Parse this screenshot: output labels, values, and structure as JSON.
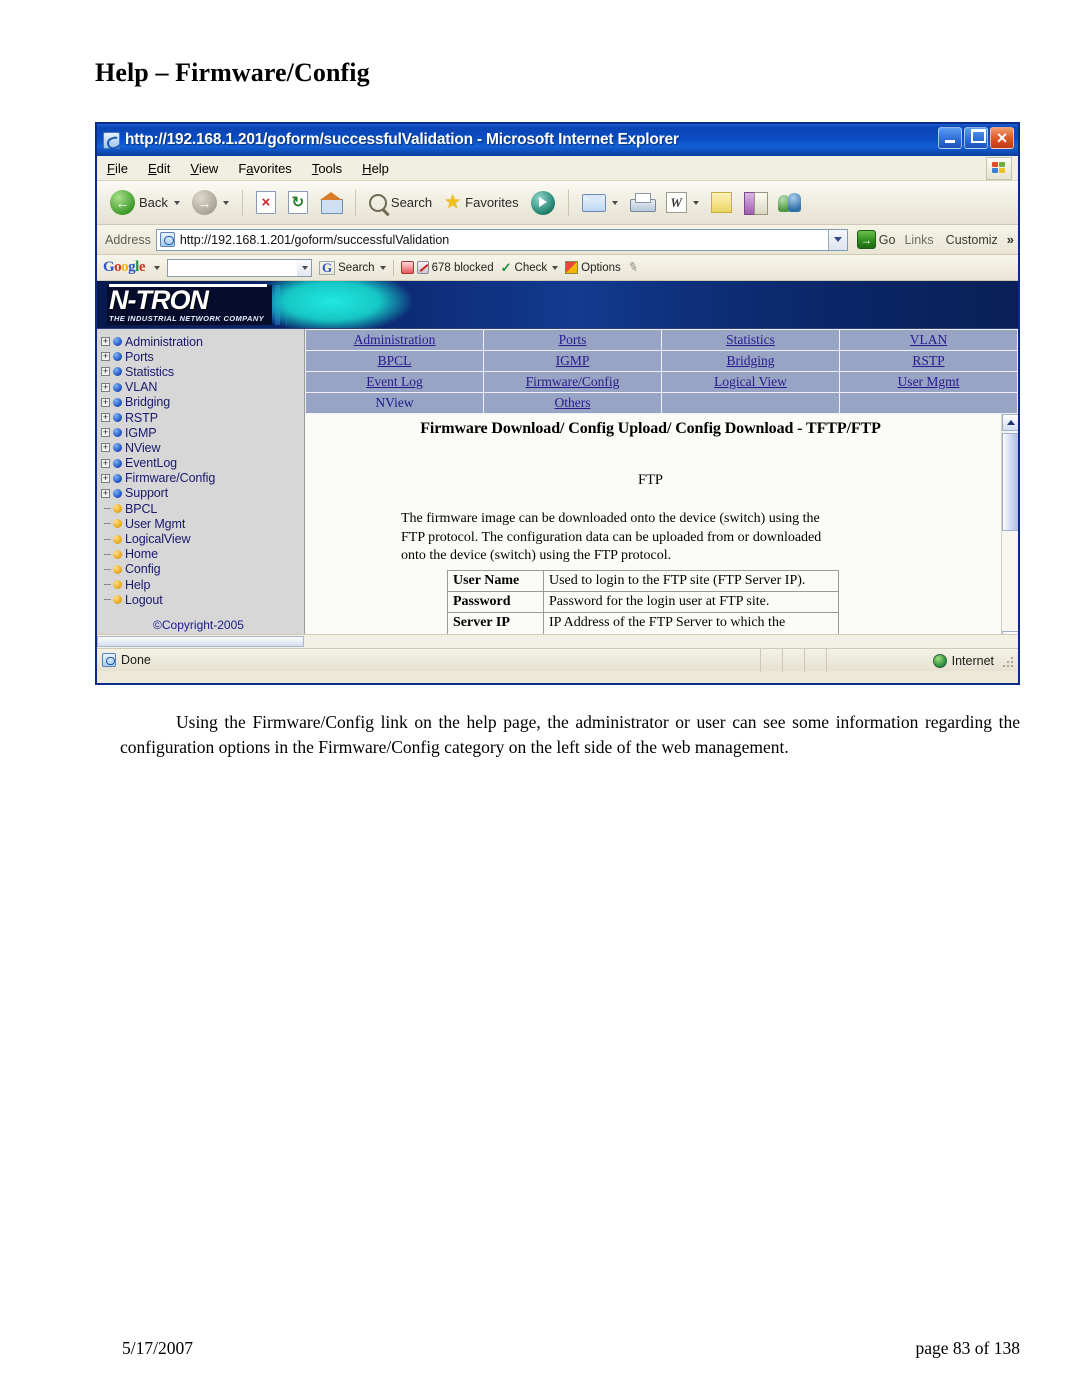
{
  "document": {
    "heading": "Help – Firmware/Config",
    "body_paragraph": "Using the Firmware/Config link on the help page, the administrator or user can see some information regarding the configuration options in the Firmware/Config category on the left side of the web management.",
    "footer_date": "5/17/2007",
    "footer_page": "page 83 of 138"
  },
  "browser": {
    "title": "http://192.168.1.201/goform/successfulValidation - Microsoft Internet Explorer",
    "window_buttons": [
      "minimize",
      "maximize",
      "close"
    ],
    "menu": [
      "File",
      "Edit",
      "View",
      "Favorites",
      "Tools",
      "Help"
    ],
    "toolbar": {
      "back_label": "Back",
      "forward_label": "",
      "stop_label": "",
      "refresh_label": "",
      "home_label": "",
      "search_label": "Search",
      "favorites_label": "Favorites",
      "media_label": "",
      "mail_label": "",
      "print_label": "",
      "edit_label": "W",
      "notes_label": "",
      "research_label": "",
      "messenger_label": ""
    },
    "address": {
      "label": "Address",
      "value": "http://192.168.1.201/goform/successfulValidation",
      "go_label": "Go",
      "links_label": "Links",
      "customize_label": "Customiz",
      "overflow_label": "»"
    },
    "google_toolbar": {
      "logo": "Google",
      "search_value": "",
      "search_label": "Search",
      "blocked_label": "678 blocked",
      "check_label": "Check",
      "options_label": "Options"
    },
    "status": {
      "text": "Done",
      "zone": "Internet"
    }
  },
  "webpage": {
    "banner": {
      "logo_main": "N-TRON",
      "logo_sub": "THE INDUSTRIAL NETWORK COMPANY"
    },
    "sidebar": {
      "items": [
        {
          "label": "Administration",
          "expandable": true,
          "dot": "blue"
        },
        {
          "label": "Ports",
          "expandable": true,
          "dot": "blue"
        },
        {
          "label": "Statistics",
          "expandable": true,
          "dot": "blue"
        },
        {
          "label": "VLAN",
          "expandable": true,
          "dot": "blue"
        },
        {
          "label": "Bridging",
          "expandable": true,
          "dot": "blue"
        },
        {
          "label": "RSTP",
          "expandable": true,
          "dot": "blue"
        },
        {
          "label": "IGMP",
          "expandable": true,
          "dot": "blue"
        },
        {
          "label": "NView",
          "expandable": true,
          "dot": "blue"
        },
        {
          "label": "EventLog",
          "expandable": true,
          "dot": "blue"
        },
        {
          "label": "Firmware/Config",
          "expandable": true,
          "dot": "blue"
        },
        {
          "label": "Support",
          "expandable": true,
          "dot": "blue"
        },
        {
          "label": "BPCL",
          "expandable": false,
          "dot": "gold"
        },
        {
          "label": "User Mgmt",
          "expandable": false,
          "dot": "gold"
        },
        {
          "label": "LogicalView",
          "expandable": false,
          "dot": "gold"
        },
        {
          "label": "Home",
          "expandable": false,
          "dot": "gold"
        },
        {
          "label": "Config",
          "expandable": false,
          "dot": "gold"
        },
        {
          "label": "Help",
          "expandable": false,
          "dot": "gold"
        },
        {
          "label": "Logout",
          "expandable": false,
          "dot": "gold"
        }
      ],
      "copyright": "©Copyright-2005",
      "url": "http://www.n-tron.com"
    },
    "link_grid": {
      "rows": [
        [
          {
            "label": "Administration",
            "link": true
          },
          {
            "label": "Ports",
            "link": true
          },
          {
            "label": "Statistics",
            "link": true
          },
          {
            "label": "VLAN",
            "link": true
          }
        ],
        [
          {
            "label": "BPCL",
            "link": true
          },
          {
            "label": "IGMP",
            "link": true
          },
          {
            "label": "Bridging",
            "link": true
          },
          {
            "label": "RSTP",
            "link": true
          }
        ],
        [
          {
            "label": "Event Log",
            "link": true
          },
          {
            "label": "Firmware/Config",
            "link": true
          },
          {
            "label": "Logical View",
            "link": true
          },
          {
            "label": "User Mgmt",
            "link": true
          }
        ],
        [
          {
            "label": "NView",
            "link": false
          },
          {
            "label": "Others",
            "link": true
          },
          {
            "label": "",
            "link": false
          },
          {
            "label": "",
            "link": false
          }
        ]
      ]
    },
    "content": {
      "title": "Firmware Download/ Config Upload/ Config Download - TFTP/FTP",
      "section": "FTP",
      "paragraph": "The firmware image can be downloaded onto the device (switch) using the FTP protocol. The configuration data can be uploaded from or downloaded onto the device (switch) using the FTP protocol.",
      "definitions": [
        {
          "term": "User Name",
          "description": "Used to login to the FTP site (FTP Server IP)."
        },
        {
          "term": "Password",
          "description": "Password for the login user at FTP site."
        },
        {
          "term": "Server IP",
          "description": "IP Address of the FTP Server to which the connection is to be established in order to get the Firmware / Configuration data."
        }
      ]
    }
  },
  "colors": {
    "titlebar_blue": "#0b4ec4",
    "banner_navy": "#0a2468",
    "banner_cyan": "#16c7c5",
    "linkgrid_bg": "#97a4c4",
    "link_text": "#2a1a8c",
    "tree_text": "#1a1a6e",
    "sidebar_bg": "#d7d7d7"
  }
}
